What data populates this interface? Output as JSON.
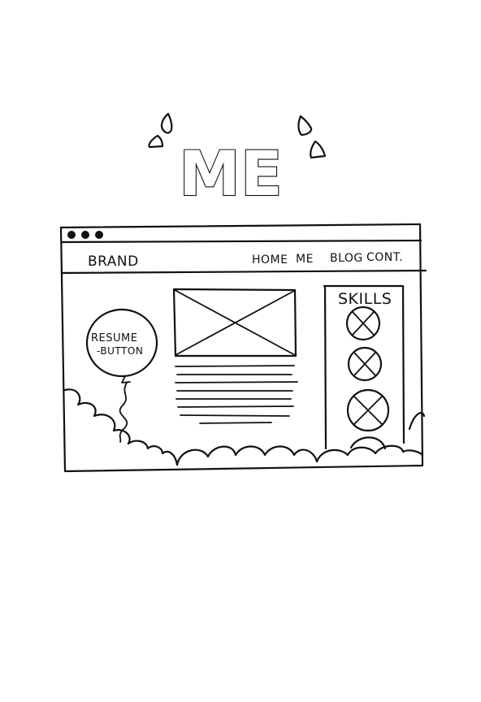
{
  "title": "ME",
  "browser": {
    "brand": "BRAND",
    "nav": {
      "home": "HOME",
      "me": "ME",
      "blog": "BLOG",
      "contact": "CONT."
    }
  },
  "resume_balloon": {
    "line1": "RESUME",
    "line2": "-BUTTON"
  },
  "skills": {
    "heading": "SKILLS"
  },
  "colors": {
    "ink": "#111111",
    "paper": "#ffffff"
  }
}
